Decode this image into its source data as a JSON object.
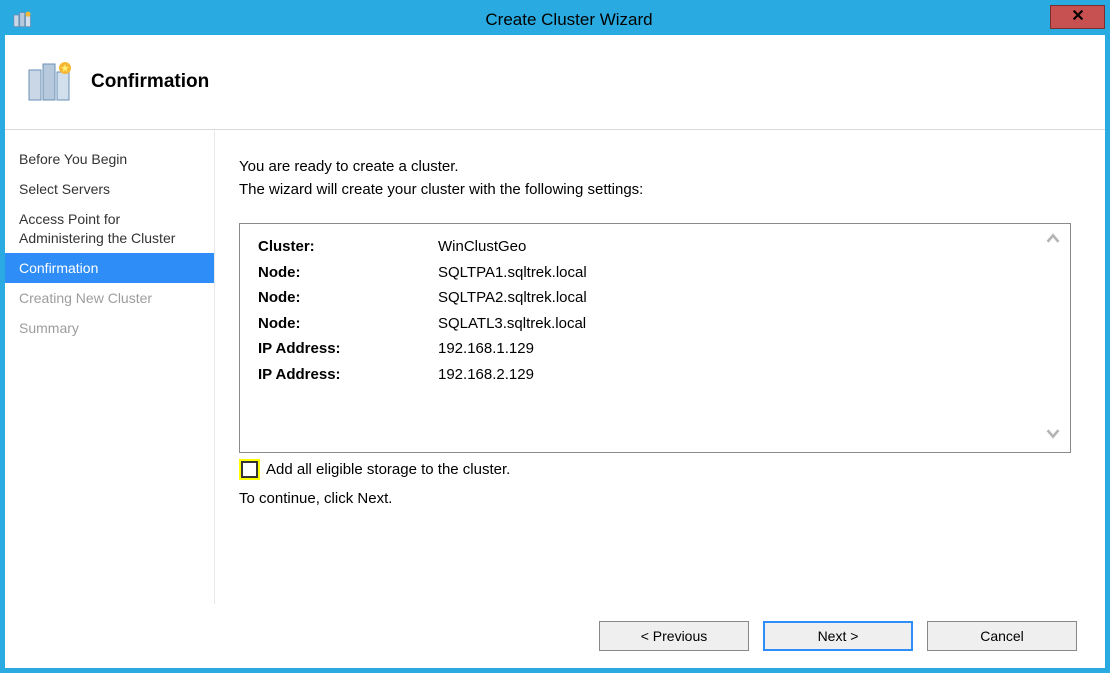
{
  "window": {
    "title": "Create Cluster Wizard"
  },
  "header": {
    "page_title": "Confirmation"
  },
  "sidebar": {
    "items": [
      {
        "label": "Before You Begin",
        "state": "normal"
      },
      {
        "label": "Select Servers",
        "state": "normal"
      },
      {
        "label": "Access Point for Administering the Cluster",
        "state": "normal"
      },
      {
        "label": "Confirmation",
        "state": "selected"
      },
      {
        "label": "Creating New Cluster",
        "state": "disabled"
      },
      {
        "label": "Summary",
        "state": "disabled"
      }
    ]
  },
  "main": {
    "intro_line1": "You are ready to create a cluster.",
    "intro_line2": "The wizard will create your cluster with the following settings:",
    "settings": [
      {
        "label": "Cluster:",
        "value": "WinClustGeo"
      },
      {
        "label": "Node:",
        "value": "SQLTPA1.sqltrek.local"
      },
      {
        "label": "Node:",
        "value": "SQLTPA2.sqltrek.local"
      },
      {
        "label": "Node:",
        "value": "SQLATL3.sqltrek.local"
      },
      {
        "label": "IP Address:",
        "value": "192.168.1.129"
      },
      {
        "label": "IP Address:",
        "value": "192.168.2.129"
      }
    ],
    "checkbox": {
      "checked": false,
      "label": "Add all eligible storage to the cluster."
    },
    "continue_hint": "To continue, click Next."
  },
  "footer": {
    "previous": "< Previous",
    "next": "Next >",
    "cancel": "Cancel"
  }
}
